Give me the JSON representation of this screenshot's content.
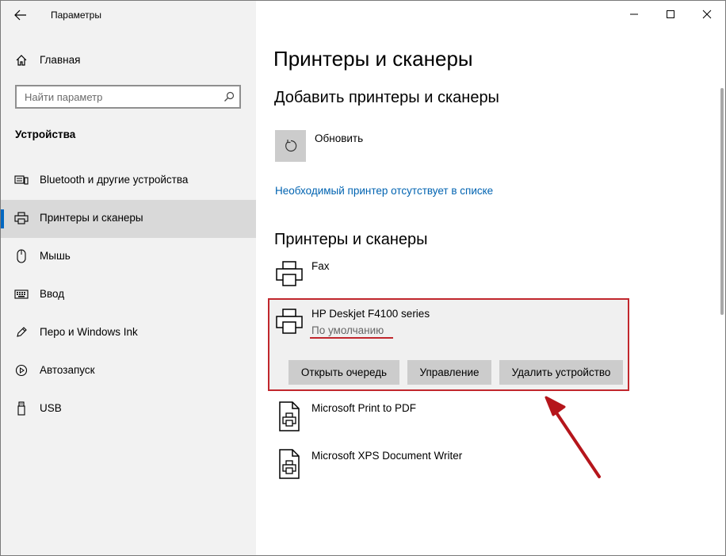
{
  "window": {
    "title": "Параметры"
  },
  "sidebar": {
    "home_label": "Главная",
    "search_placeholder": "Найти параметр",
    "section_title": "Устройства",
    "items": [
      {
        "label": "Bluetooth и другие устройства",
        "icon": "bluetooth-devices-icon"
      },
      {
        "label": "Принтеры и сканеры",
        "icon": "printer-icon",
        "selected": true
      },
      {
        "label": "Мышь",
        "icon": "mouse-icon"
      },
      {
        "label": "Ввод",
        "icon": "keyboard-icon"
      },
      {
        "label": "Перо и Windows Ink",
        "icon": "pen-icon"
      },
      {
        "label": "Автозапуск",
        "icon": "autoplay-icon"
      },
      {
        "label": "USB",
        "icon": "usb-icon"
      }
    ]
  },
  "main": {
    "title": "Принтеры и сканеры",
    "add_heading": "Добавить принтеры и сканеры",
    "refresh_label": "Обновить",
    "missing_link": "Необходимый принтер отсутствует в списке",
    "list_heading": "Принтеры и сканеры",
    "printers": [
      {
        "name": "Fax"
      },
      {
        "name": "HP Deskjet F4100 series",
        "status": "По умолчанию",
        "expanded": true
      },
      {
        "name": "Microsoft Print to PDF"
      },
      {
        "name": "Microsoft XPS Document Writer"
      }
    ],
    "actions": {
      "open_queue": "Открыть очередь",
      "manage": "Управление",
      "remove": "Удалить устройство"
    }
  },
  "colors": {
    "accent": "#0067c0",
    "link": "#0063b1",
    "annotation": "#c1272d",
    "sidebar_bg": "#f2f2f2"
  }
}
